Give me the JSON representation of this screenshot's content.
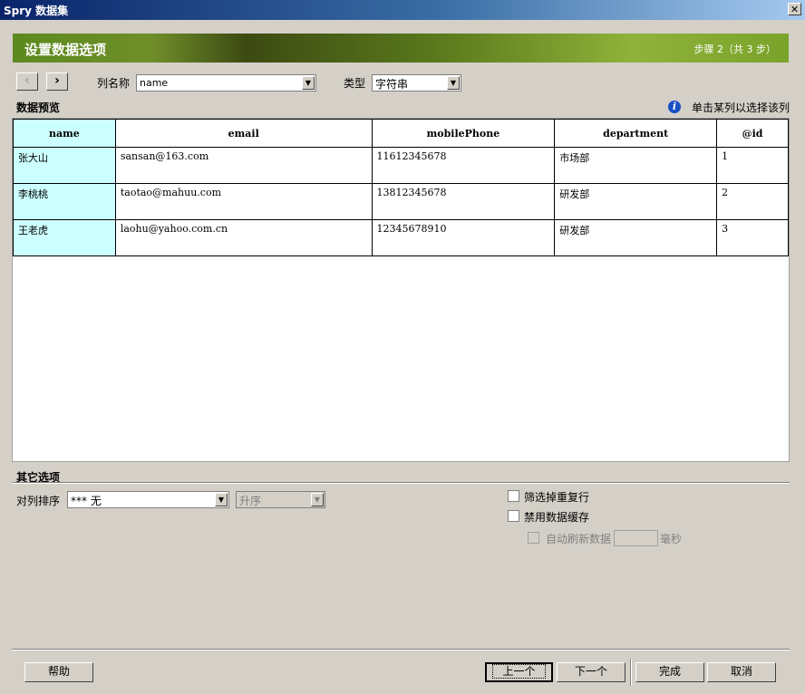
{
  "window": {
    "title": "Spry 数据集",
    "close": "✕"
  },
  "banner": {
    "heading": "设置数据选项",
    "step": "步骤 2（共 3 步）"
  },
  "nav": {
    "prev": "‹",
    "next": "›"
  },
  "column": {
    "label": "列名称",
    "value": "name"
  },
  "type": {
    "label": "类型",
    "value": "字符串"
  },
  "preview": {
    "title": "数据预览",
    "hint": "单击某列以选择该列",
    "info_icon": "i",
    "columns": [
      "name",
      "email",
      "mobilePhone",
      "department",
      "@id"
    ],
    "rows": [
      [
        "张大山",
        "sansan@163.com",
        "11612345678",
        "市场部",
        "1"
      ],
      [
        "李桃桃",
        "taotao@mahuu.com",
        "13812345678",
        "研发部",
        "2"
      ],
      [
        "王老虎",
        "laohu@yahoo.com.cn",
        "12345678910",
        "研发部",
        "3"
      ]
    ]
  },
  "other": {
    "title": "其它选项",
    "sort_label": "对列排序",
    "sort_value": "*** 无",
    "order_value": "升序",
    "filter_dupes": "筛选掉重复行",
    "disable_cache": "禁用数据缓存",
    "auto_refresh": "自动刷新数据",
    "ms": "毫秒"
  },
  "buttons": {
    "help": "帮助",
    "back": "上一个",
    "next": "下一个",
    "finish": "完成",
    "cancel": "取消"
  }
}
